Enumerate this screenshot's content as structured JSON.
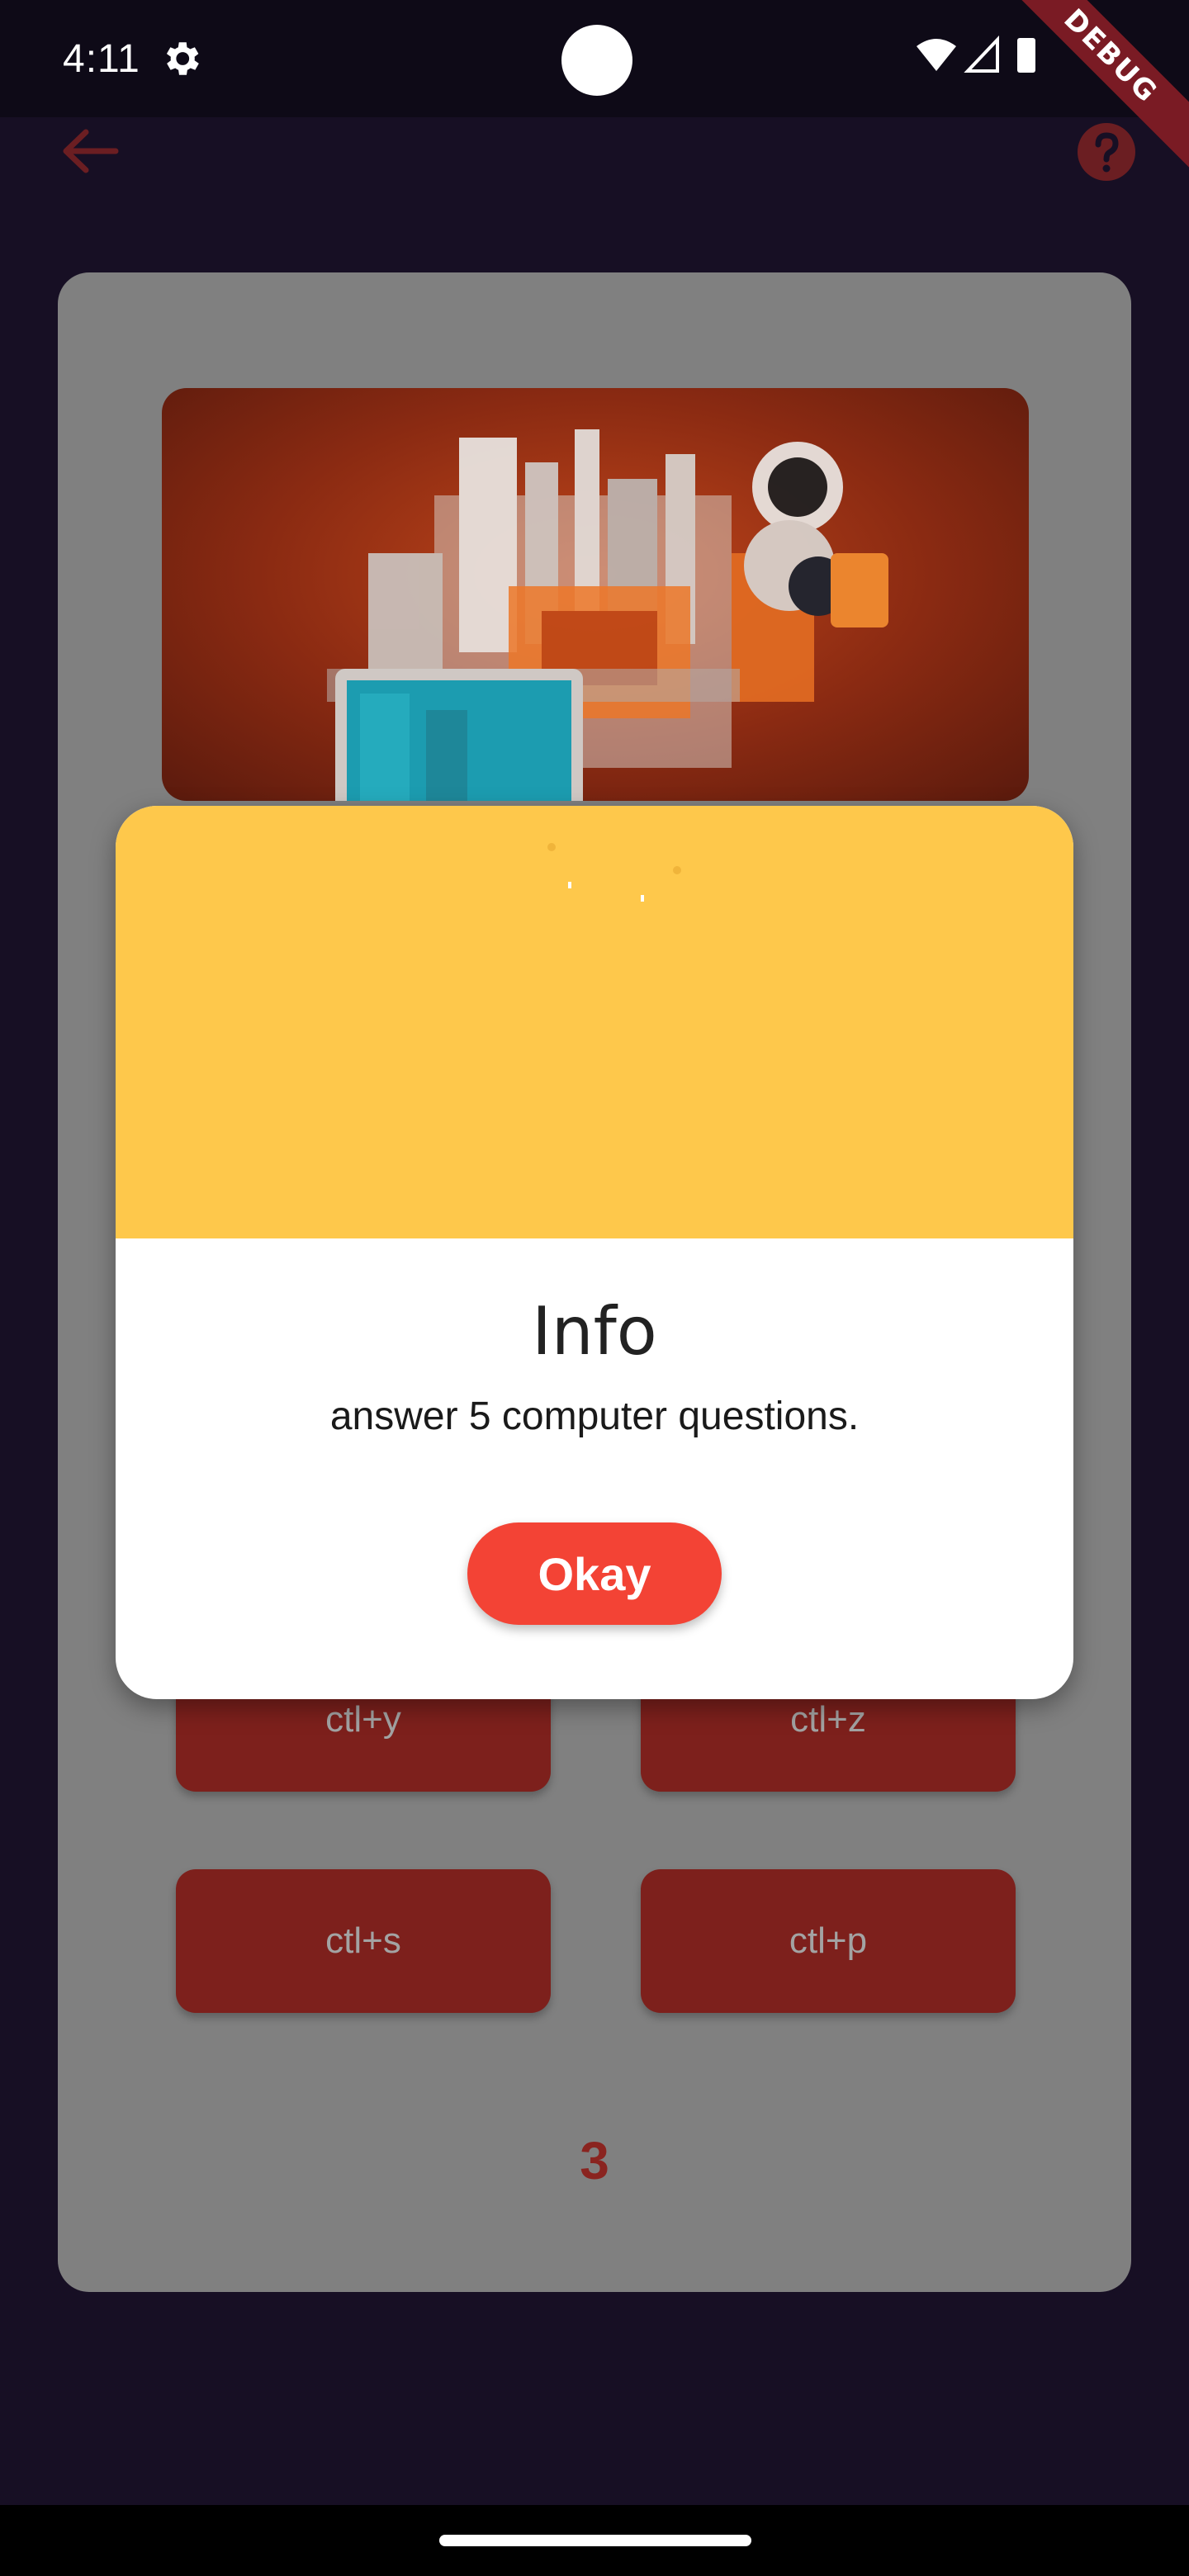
{
  "status_bar": {
    "time": "4:11",
    "debug_label": "DEBUG"
  },
  "app_bar": {
    "back_icon": "arrow-left-icon",
    "help_icon": "help-circle-icon"
  },
  "quiz": {
    "answers": [
      "ctl+y",
      "ctl+z",
      "ctl+s",
      "ctl+p"
    ],
    "counter": "3"
  },
  "dialog": {
    "title": "Info",
    "message": "answer 5 computer questions.",
    "okay_label": "Okay"
  },
  "colors": {
    "background": "#170f24",
    "accent_red": "#f34335",
    "dialog_header": "#fec84b",
    "answer_button": "#7d201c"
  }
}
